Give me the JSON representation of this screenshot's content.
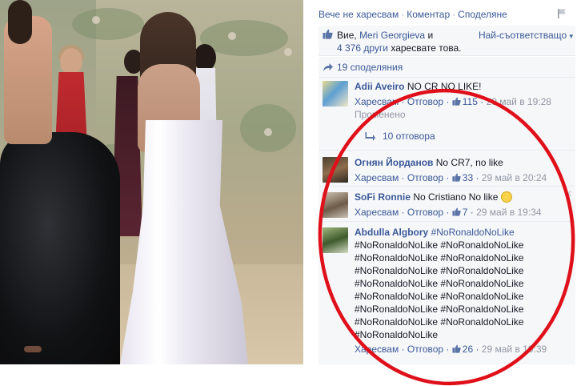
{
  "photo": {
    "alt_icon": "photo-image"
  },
  "topbar": {
    "unlike": "Вече не харесвам",
    "comment": "Коментар",
    "share": "Споделяне",
    "separator": "·"
  },
  "likes": {
    "prefix": "Вие,",
    "name": "Meri Georgieva",
    "and": "и",
    "others": "4 376 други",
    "suffix": "харесвате това.",
    "sort_label": "Най-съответстващо",
    "sort_arrow": "▾"
  },
  "shares": {
    "label": "19 споделяния"
  },
  "colors": {
    "link": "#3b5998",
    "panel_bg": "#f6f7f9",
    "annotation": "#e0101a"
  },
  "comments": [
    {
      "author": "Adii Aveiro",
      "text": "NO CR NO LIKE!",
      "like_label": "Харесвам",
      "reply_label": "Отговор",
      "likes": "115",
      "time": "29 май в 19:28",
      "edited": "Променено",
      "replies": "10 отговора"
    },
    {
      "author": "Огнян Йорданов",
      "text": "No CR7, no like",
      "like_label": "Харесвам",
      "reply_label": "Отговор",
      "likes": "33",
      "time": "29 май в 20:24"
    },
    {
      "author": "SoFi Ronnie",
      "text": "No Cristiano No like",
      "like_label": "Харесвам",
      "reply_label": "Отговор",
      "likes": "7",
      "time": "29 май в 19:34"
    },
    {
      "author": "Abdulla Algbory",
      "hashtag": "#NoRonaldoNoLike",
      "lines": [
        "#NoRonaldoNoLike #NoRonaldoNoLike",
        "#NoRonaldoNoLike #NoRonaldoNoLike",
        "#NoRonaldoNoLike #NoRonaldoNoLike",
        "#NoRonaldoNoLike #NoRonaldoNoLike",
        "#NoRonaldoNoLike #NoRonaldoNoLike",
        "#NoRonaldoNoLike #NoRonaldoNoLike",
        "#NoRonaldoNoLike #NoRonaldoNoLike",
        "#NoRonaldoNoLike"
      ],
      "like_label": "Харесвам",
      "reply_label": "Отговор",
      "likes": "26",
      "time": "29 май в 19:39"
    }
  ]
}
